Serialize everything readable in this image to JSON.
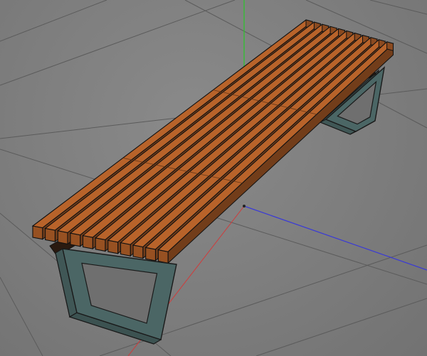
{
  "viewport": {
    "mode": "perspective-3d-viewport",
    "background": "#7d7d7d",
    "grid_color": "#5b5b5b"
  },
  "axes": {
    "x_axis_color": "#d13a3a",
    "y_axis_color": "#2fc12f",
    "z_axis_color": "#3a3ad6"
  },
  "model": {
    "object": "slatted-bench",
    "slat_count": 11,
    "slat_color": "#b8632a",
    "slat_edge_color": "#111111",
    "leg_color": "#4b6665",
    "leg_edge_color": "#1a1a1a"
  }
}
